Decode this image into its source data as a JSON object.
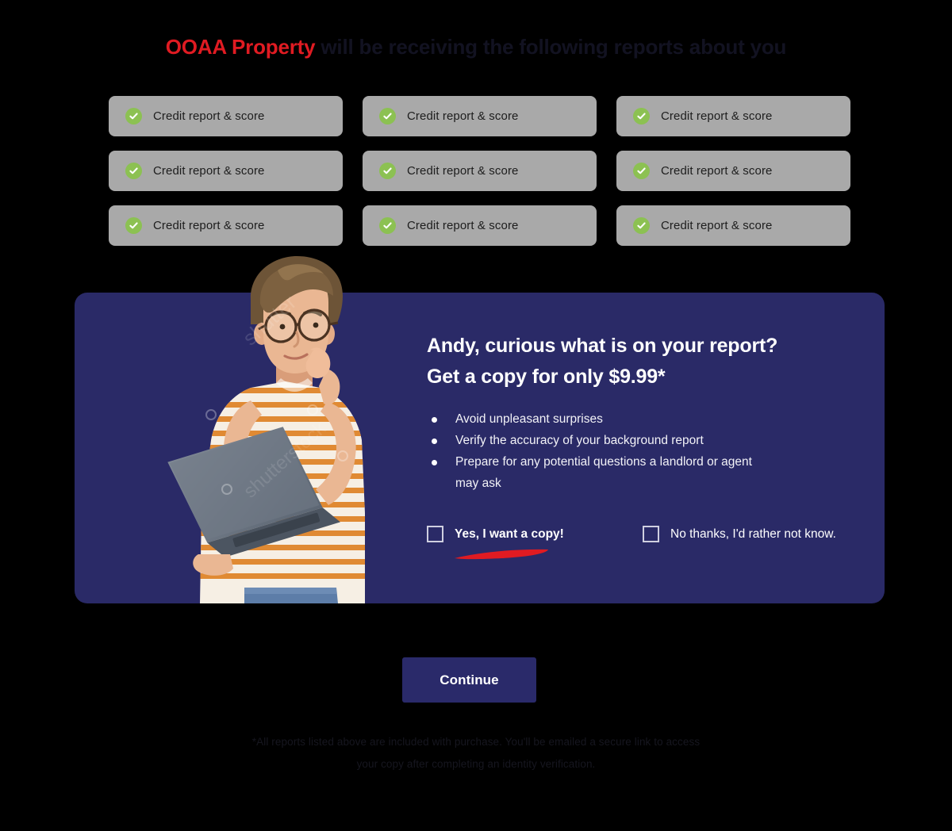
{
  "heading": {
    "brand": "OOAA Property",
    "rest": " will be receiving the following reports about you"
  },
  "reports": {
    "items": [
      {
        "label": "Credit report & score",
        "icon": "check-circle-icon"
      },
      {
        "label": "Credit report & score",
        "icon": "check-circle-icon"
      },
      {
        "label": "Credit report & score",
        "icon": "check-circle-icon"
      },
      {
        "label": "Credit report & score",
        "icon": "check-circle-icon"
      },
      {
        "label": "Credit report & score",
        "icon": "check-circle-icon"
      },
      {
        "label": "Credit report & score",
        "icon": "check-circle-icon"
      },
      {
        "label": "Credit report & score",
        "icon": "check-circle-icon"
      },
      {
        "label": "Credit report & score",
        "icon": "check-circle-icon"
      },
      {
        "label": "Credit report & score",
        "icon": "check-circle-icon"
      }
    ]
  },
  "promo": {
    "title_line1": "Andy, curious what is on your report?",
    "title_line2": "Get a copy for only $9.99*",
    "price": "$9.99",
    "bullets": [
      "Avoid unpleasant surprises",
      "Verify the accuracy of your background report",
      "Prepare for any potential questions a landlord or agent may ask"
    ],
    "choice_yes": "Yes, I want a copy!",
    "choice_no": "No thanks, I'd rather not know.",
    "photo_alt": "man-with-laptop-thinking-photo",
    "watermark": "shutterstock"
  },
  "actions": {
    "continue_label": "Continue"
  },
  "footnote": {
    "line1": "*All reports listed above are included with purchase. You'll be emailed a secure link to access",
    "line2": "your copy after completing an identity verification."
  },
  "colors": {
    "page_background": "#000000",
    "brand_red": "#e01b22",
    "panel_navy": "#2a2a67",
    "card_gray": "#a9a9a9",
    "check_green": "#8cc152",
    "button_navy": "#2a2a6a",
    "text_white": "#ffffff"
  }
}
